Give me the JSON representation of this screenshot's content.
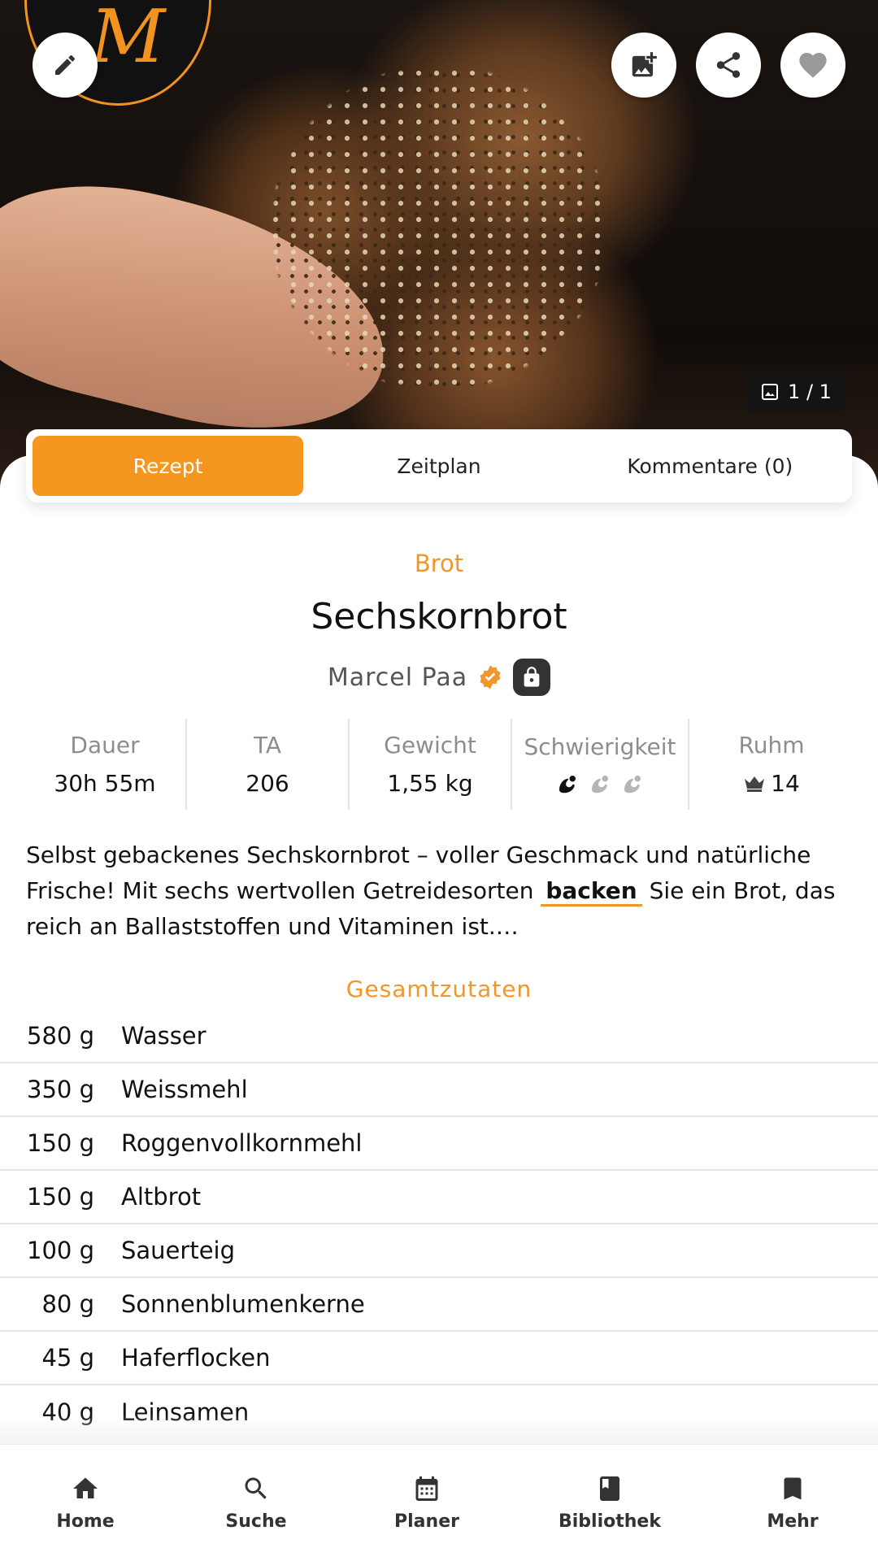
{
  "hero": {
    "image_counter": "1 / 1",
    "logo_letter": "M"
  },
  "top_actions": {
    "edit_icon": "pencil-icon",
    "add_photo_icon": "add-photo-icon",
    "share_icon": "share-icon",
    "favorite_icon": "heart-icon"
  },
  "tabs": [
    {
      "label": "Rezept",
      "active": true
    },
    {
      "label": "Zeitplan",
      "active": false
    },
    {
      "label": "Kommentare (0)",
      "active": false
    }
  ],
  "recipe": {
    "category": "Brot",
    "title": "Sechskornbrot",
    "author": "Marcel Paa"
  },
  "stats": {
    "duration_label": "Dauer",
    "duration_value": "30h 55m",
    "ta_label": "TA",
    "ta_value": "206",
    "weight_label": "Gewicht",
    "weight_value": "1,55 kg",
    "difficulty_label": "Schwierigkeit",
    "difficulty_level": 1,
    "difficulty_max": 3,
    "fame_label": "Ruhm",
    "fame_value": "14"
  },
  "description": {
    "part1": "Selbst gebackenes Sechskornbrot – voller Geschmack und natürliche Frische! Mit sechs wertvollen Getreidesorten",
    "link": "backen",
    "part2": "Sie ein Brot, das reich an Ballaststoffen und Vitaminen ist.…"
  },
  "ingredients_title": "Gesamtzutaten",
  "ingredients": [
    {
      "qty": "580 g",
      "name": "Wasser"
    },
    {
      "qty": "350 g",
      "name": "Weissmehl"
    },
    {
      "qty": "150 g",
      "name": "Roggenvollkornmehl"
    },
    {
      "qty": "150 g",
      "name": "Altbrot"
    },
    {
      "qty": "100 g",
      "name": "Sauerteig"
    },
    {
      "qty": "80 g",
      "name": "Sonnenblumenkerne"
    },
    {
      "qty": "45 g",
      "name": "Haferflocken"
    },
    {
      "qty": "40 g",
      "name": "Leinsamen"
    }
  ],
  "nav": [
    {
      "label": "Home",
      "icon": "home-icon"
    },
    {
      "label": "Suche",
      "icon": "search-icon"
    },
    {
      "label": "Planer",
      "icon": "calendar-icon"
    },
    {
      "label": "Bibliothek",
      "icon": "book-icon"
    },
    {
      "label": "Mehr",
      "icon": "bookmark-icon"
    }
  ],
  "colors": {
    "accent": "#f5961f",
    "verified": "#f0962b"
  }
}
